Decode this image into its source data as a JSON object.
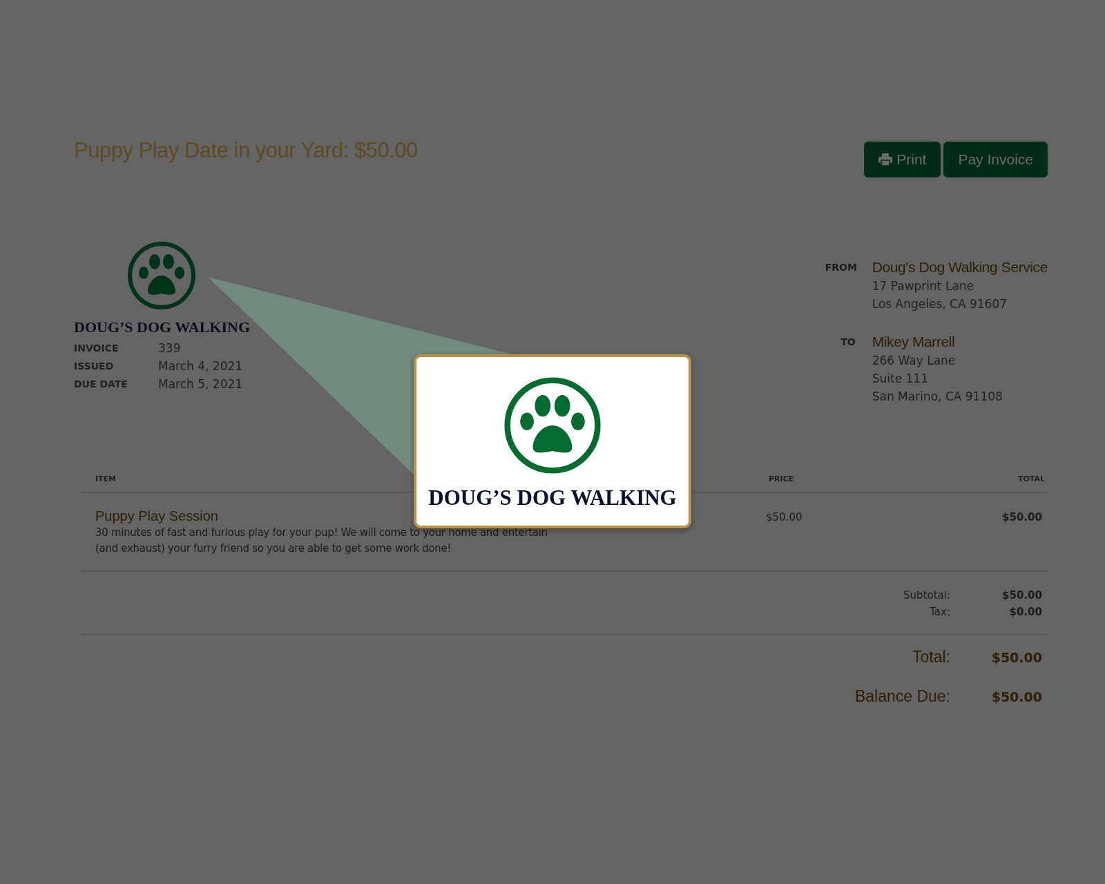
{
  "header": {
    "title": "Puppy Play Date in your Yard: $50.00",
    "buttons": [
      {
        "label": "Print",
        "kind": "print"
      },
      {
        "label": "Pay Invoice",
        "kind": "plain"
      }
    ]
  },
  "brand": {
    "name": "DOUG’S DOG WALKING"
  },
  "meta": [
    {
      "label": "INVOICE",
      "value": "339"
    },
    {
      "label": "ISSUED",
      "value": "March 4, 2021"
    },
    {
      "label": "DUE DATE",
      "value": "March 5, 2021"
    }
  ],
  "parties": [
    {
      "label": "FROM",
      "name": "Doug's Dog Walking Service",
      "lines": [
        "17 Pawprint Lane",
        "Los Angeles, CA 91607"
      ]
    },
    {
      "label": "TO",
      "name": "Mikey Marrell",
      "lines": [
        "266 Way Lane",
        "Suite 111",
        "San Marino, CA 91108"
      ]
    }
  ],
  "table": {
    "columns": [
      "ITEM",
      "PRICE",
      "TOTAL"
    ],
    "rows": [
      {
        "item": "Puppy Play Session",
        "description": "30 minutes of fast and furious play for your pup! We will come to your home and entertain (and exhaust) your furry friend so you are able to get some work done!",
        "price": "$50.00",
        "total": "$50.00"
      }
    ]
  },
  "summary": [
    {
      "label": "Subtotal:",
      "value": "$50.00"
    },
    {
      "label": "Tax:",
      "value": "$0.00"
    }
  ],
  "totals": [
    {
      "label": "Total:",
      "value": "$50.00"
    },
    {
      "label": "Balance Due:",
      "value": "$50.00"
    }
  ],
  "callout": {
    "brand": "DOUG’S DOG WALKING"
  }
}
